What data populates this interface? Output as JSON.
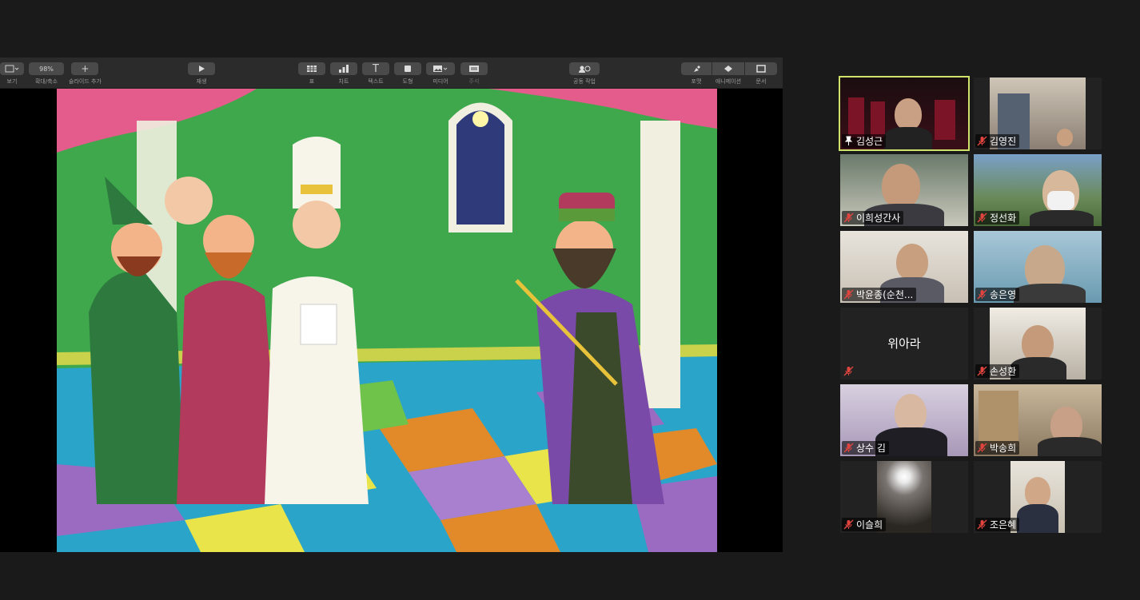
{
  "toolbar": {
    "items": [
      {
        "label": "보기",
        "btn": ""
      },
      {
        "label": "확대/축소",
        "btn": "98%"
      },
      {
        "label": "슬라이드 추가",
        "btn": "+"
      },
      {
        "label": "재생",
        "btn": ""
      },
      {
        "label": "표",
        "btn": ""
      },
      {
        "label": "차트",
        "btn": ""
      },
      {
        "label": "텍스트",
        "btn": "T"
      },
      {
        "label": "도형",
        "btn": ""
      },
      {
        "label": "미디어",
        "btn": ""
      },
      {
        "label": "주석",
        "btn": ""
      },
      {
        "label": "공동 작업",
        "btn": ""
      },
      {
        "label": "포맷",
        "btn": ""
      },
      {
        "label": "애니메이션",
        "btn": ""
      },
      {
        "label": "문서",
        "btn": ""
      }
    ]
  },
  "participants": [
    {
      "name": "김성근",
      "status": "pinned",
      "active": true
    },
    {
      "name": "김영진",
      "status": "muted"
    },
    {
      "name": "이희성간사",
      "status": "muted"
    },
    {
      "name": "정선화",
      "status": "muted"
    },
    {
      "name": "박윤종(순천...",
      "status": "muted"
    },
    {
      "name": "송은영",
      "status": "muted"
    },
    {
      "name": "위아라",
      "status": "muted",
      "video_off": true
    },
    {
      "name": "손성환",
      "status": "muted"
    },
    {
      "name": "상수 김",
      "status": "muted"
    },
    {
      "name": "박송희",
      "status": "muted"
    },
    {
      "name": "이슬희",
      "status": "muted"
    },
    {
      "name": "조은혜",
      "status": "muted"
    }
  ],
  "colors": {
    "active_outline": "#cfe36a",
    "muted_icon": "#e0443e",
    "background": "#1a1a1a"
  }
}
